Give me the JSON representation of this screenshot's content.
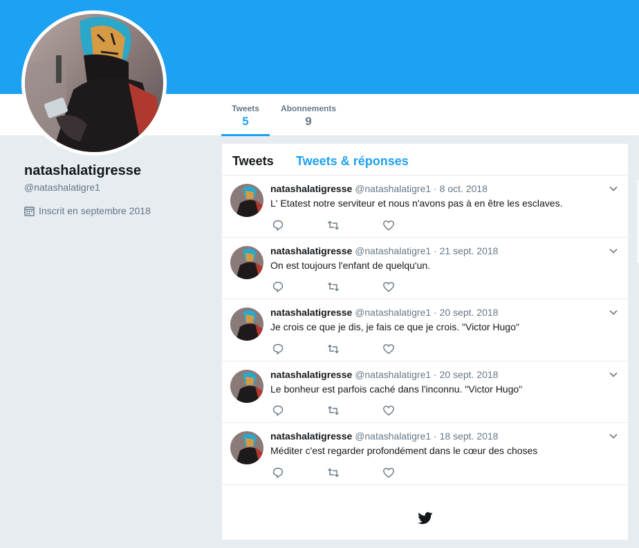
{
  "profile": {
    "name": "natashalatigresse",
    "handle": "@natashalatigre1",
    "joined": "Inscrit en septembre 2018"
  },
  "nav": {
    "tweets_label": "Tweets",
    "tweets_count": "5",
    "following_label": "Abonnements",
    "following_count": "9"
  },
  "timeline": {
    "tab_tweets": "Tweets",
    "tab_replies": "Tweets & réponses"
  },
  "tweets": [
    {
      "name": "natashalatigresse",
      "meta": "@natashalatigre1 · 8 oct. 2018",
      "text": "L' Etatest notre serviteur et nous n'avons pas à en être les esclaves."
    },
    {
      "name": "natashalatigresse",
      "meta": "@natashalatigre1 · 21 sept. 2018",
      "text": "On est toujours l'enfant de quelqu'un."
    },
    {
      "name": "natashalatigresse",
      "meta": "@natashalatigre1 · 20 sept. 2018",
      "text": "Je crois ce que je dis, je fais ce que je crois. \"Victor Hugo\""
    },
    {
      "name": "natashalatigresse",
      "meta": "@natashalatigre1 · 20 sept. 2018",
      "text": "Le bonheur est parfois caché dans l'inconnu. \"Victor Hugo\""
    },
    {
      "name": "natashalatigresse",
      "meta": "@natashalatigre1 · 18 sept. 2018",
      "text": "Méditer c'est regarder profondément dans le cœur des choses"
    }
  ],
  "colors": {
    "brand": "#1da1f2",
    "background": "#e6ecf0",
    "muted": "#657786"
  },
  "icons": [
    "calendar-icon",
    "chevron-down-icon",
    "reply-icon",
    "retweet-icon",
    "like-icon",
    "twitter-bird-icon"
  ]
}
